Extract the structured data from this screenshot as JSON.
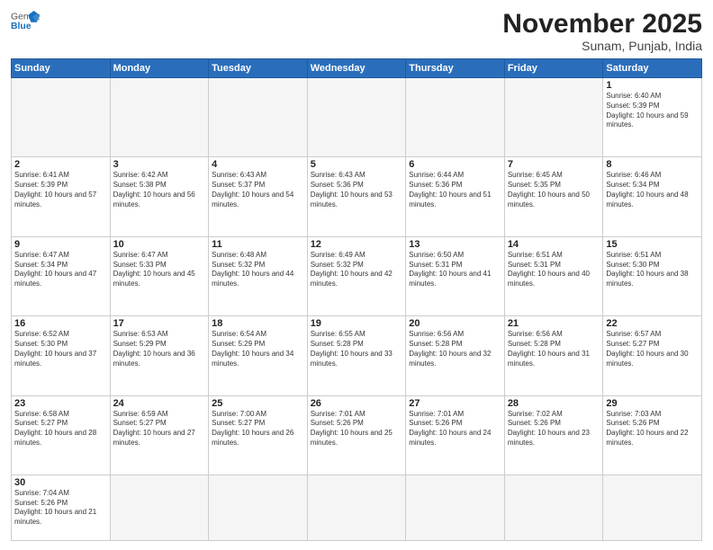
{
  "header": {
    "logo_general": "General",
    "logo_blue": "Blue",
    "month_title": "November 2025",
    "subtitle": "Sunam, Punjab, India"
  },
  "days_of_week": [
    "Sunday",
    "Monday",
    "Tuesday",
    "Wednesday",
    "Thursday",
    "Friday",
    "Saturday"
  ],
  "weeks": [
    [
      {
        "day": "",
        "sunrise": "",
        "sunset": "",
        "daylight": "",
        "empty": true
      },
      {
        "day": "",
        "sunrise": "",
        "sunset": "",
        "daylight": "",
        "empty": true
      },
      {
        "day": "",
        "sunrise": "",
        "sunset": "",
        "daylight": "",
        "empty": true
      },
      {
        "day": "",
        "sunrise": "",
        "sunset": "",
        "daylight": "",
        "empty": true
      },
      {
        "day": "",
        "sunrise": "",
        "sunset": "",
        "daylight": "",
        "empty": true
      },
      {
        "day": "",
        "sunrise": "",
        "sunset": "",
        "daylight": "",
        "empty": true
      },
      {
        "day": "1",
        "sunrise": "Sunrise: 6:40 AM",
        "sunset": "Sunset: 5:39 PM",
        "daylight": "Daylight: 10 hours and 59 minutes.",
        "empty": false
      }
    ],
    [
      {
        "day": "2",
        "sunrise": "Sunrise: 6:41 AM",
        "sunset": "Sunset: 5:39 PM",
        "daylight": "Daylight: 10 hours and 57 minutes.",
        "empty": false
      },
      {
        "day": "3",
        "sunrise": "Sunrise: 6:42 AM",
        "sunset": "Sunset: 5:38 PM",
        "daylight": "Daylight: 10 hours and 56 minutes.",
        "empty": false
      },
      {
        "day": "4",
        "sunrise": "Sunrise: 6:43 AM",
        "sunset": "Sunset: 5:37 PM",
        "daylight": "Daylight: 10 hours and 54 minutes.",
        "empty": false
      },
      {
        "day": "5",
        "sunrise": "Sunrise: 6:43 AM",
        "sunset": "Sunset: 5:36 PM",
        "daylight": "Daylight: 10 hours and 53 minutes.",
        "empty": false
      },
      {
        "day": "6",
        "sunrise": "Sunrise: 6:44 AM",
        "sunset": "Sunset: 5:36 PM",
        "daylight": "Daylight: 10 hours and 51 minutes.",
        "empty": false
      },
      {
        "day": "7",
        "sunrise": "Sunrise: 6:45 AM",
        "sunset": "Sunset: 5:35 PM",
        "daylight": "Daylight: 10 hours and 50 minutes.",
        "empty": false
      },
      {
        "day": "8",
        "sunrise": "Sunrise: 6:46 AM",
        "sunset": "Sunset: 5:34 PM",
        "daylight": "Daylight: 10 hours and 48 minutes.",
        "empty": false
      }
    ],
    [
      {
        "day": "9",
        "sunrise": "Sunrise: 6:47 AM",
        "sunset": "Sunset: 5:34 PM",
        "daylight": "Daylight: 10 hours and 47 minutes.",
        "empty": false
      },
      {
        "day": "10",
        "sunrise": "Sunrise: 6:47 AM",
        "sunset": "Sunset: 5:33 PM",
        "daylight": "Daylight: 10 hours and 45 minutes.",
        "empty": false
      },
      {
        "day": "11",
        "sunrise": "Sunrise: 6:48 AM",
        "sunset": "Sunset: 5:32 PM",
        "daylight": "Daylight: 10 hours and 44 minutes.",
        "empty": false
      },
      {
        "day": "12",
        "sunrise": "Sunrise: 6:49 AM",
        "sunset": "Sunset: 5:32 PM",
        "daylight": "Daylight: 10 hours and 42 minutes.",
        "empty": false
      },
      {
        "day": "13",
        "sunrise": "Sunrise: 6:50 AM",
        "sunset": "Sunset: 5:31 PM",
        "daylight": "Daylight: 10 hours and 41 minutes.",
        "empty": false
      },
      {
        "day": "14",
        "sunrise": "Sunrise: 6:51 AM",
        "sunset": "Sunset: 5:31 PM",
        "daylight": "Daylight: 10 hours and 40 minutes.",
        "empty": false
      },
      {
        "day": "15",
        "sunrise": "Sunrise: 6:51 AM",
        "sunset": "Sunset: 5:30 PM",
        "daylight": "Daylight: 10 hours and 38 minutes.",
        "empty": false
      }
    ],
    [
      {
        "day": "16",
        "sunrise": "Sunrise: 6:52 AM",
        "sunset": "Sunset: 5:30 PM",
        "daylight": "Daylight: 10 hours and 37 minutes.",
        "empty": false
      },
      {
        "day": "17",
        "sunrise": "Sunrise: 6:53 AM",
        "sunset": "Sunset: 5:29 PM",
        "daylight": "Daylight: 10 hours and 36 minutes.",
        "empty": false
      },
      {
        "day": "18",
        "sunrise": "Sunrise: 6:54 AM",
        "sunset": "Sunset: 5:29 PM",
        "daylight": "Daylight: 10 hours and 34 minutes.",
        "empty": false
      },
      {
        "day": "19",
        "sunrise": "Sunrise: 6:55 AM",
        "sunset": "Sunset: 5:28 PM",
        "daylight": "Daylight: 10 hours and 33 minutes.",
        "empty": false
      },
      {
        "day": "20",
        "sunrise": "Sunrise: 6:56 AM",
        "sunset": "Sunset: 5:28 PM",
        "daylight": "Daylight: 10 hours and 32 minutes.",
        "empty": false
      },
      {
        "day": "21",
        "sunrise": "Sunrise: 6:56 AM",
        "sunset": "Sunset: 5:28 PM",
        "daylight": "Daylight: 10 hours and 31 minutes.",
        "empty": false
      },
      {
        "day": "22",
        "sunrise": "Sunrise: 6:57 AM",
        "sunset": "Sunset: 5:27 PM",
        "daylight": "Daylight: 10 hours and 30 minutes.",
        "empty": false
      }
    ],
    [
      {
        "day": "23",
        "sunrise": "Sunrise: 6:58 AM",
        "sunset": "Sunset: 5:27 PM",
        "daylight": "Daylight: 10 hours and 28 minutes.",
        "empty": false
      },
      {
        "day": "24",
        "sunrise": "Sunrise: 6:59 AM",
        "sunset": "Sunset: 5:27 PM",
        "daylight": "Daylight: 10 hours and 27 minutes.",
        "empty": false
      },
      {
        "day": "25",
        "sunrise": "Sunrise: 7:00 AM",
        "sunset": "Sunset: 5:27 PM",
        "daylight": "Daylight: 10 hours and 26 minutes.",
        "empty": false
      },
      {
        "day": "26",
        "sunrise": "Sunrise: 7:01 AM",
        "sunset": "Sunset: 5:26 PM",
        "daylight": "Daylight: 10 hours and 25 minutes.",
        "empty": false
      },
      {
        "day": "27",
        "sunrise": "Sunrise: 7:01 AM",
        "sunset": "Sunset: 5:26 PM",
        "daylight": "Daylight: 10 hours and 24 minutes.",
        "empty": false
      },
      {
        "day": "28",
        "sunrise": "Sunrise: 7:02 AM",
        "sunset": "Sunset: 5:26 PM",
        "daylight": "Daylight: 10 hours and 23 minutes.",
        "empty": false
      },
      {
        "day": "29",
        "sunrise": "Sunrise: 7:03 AM",
        "sunset": "Sunset: 5:26 PM",
        "daylight": "Daylight: 10 hours and 22 minutes.",
        "empty": false
      }
    ],
    [
      {
        "day": "30",
        "sunrise": "Sunrise: 7:04 AM",
        "sunset": "Sunset: 5:26 PM",
        "daylight": "Daylight: 10 hours and 21 minutes.",
        "empty": false,
        "last": true
      },
      {
        "day": "",
        "sunrise": "",
        "sunset": "",
        "daylight": "",
        "empty": true,
        "last": true
      },
      {
        "day": "",
        "sunrise": "",
        "sunset": "",
        "daylight": "",
        "empty": true,
        "last": true
      },
      {
        "day": "",
        "sunrise": "",
        "sunset": "",
        "daylight": "",
        "empty": true,
        "last": true
      },
      {
        "day": "",
        "sunrise": "",
        "sunset": "",
        "daylight": "",
        "empty": true,
        "last": true
      },
      {
        "day": "",
        "sunrise": "",
        "sunset": "",
        "daylight": "",
        "empty": true,
        "last": true
      },
      {
        "day": "",
        "sunrise": "",
        "sunset": "",
        "daylight": "",
        "empty": true,
        "last": true
      }
    ]
  ]
}
